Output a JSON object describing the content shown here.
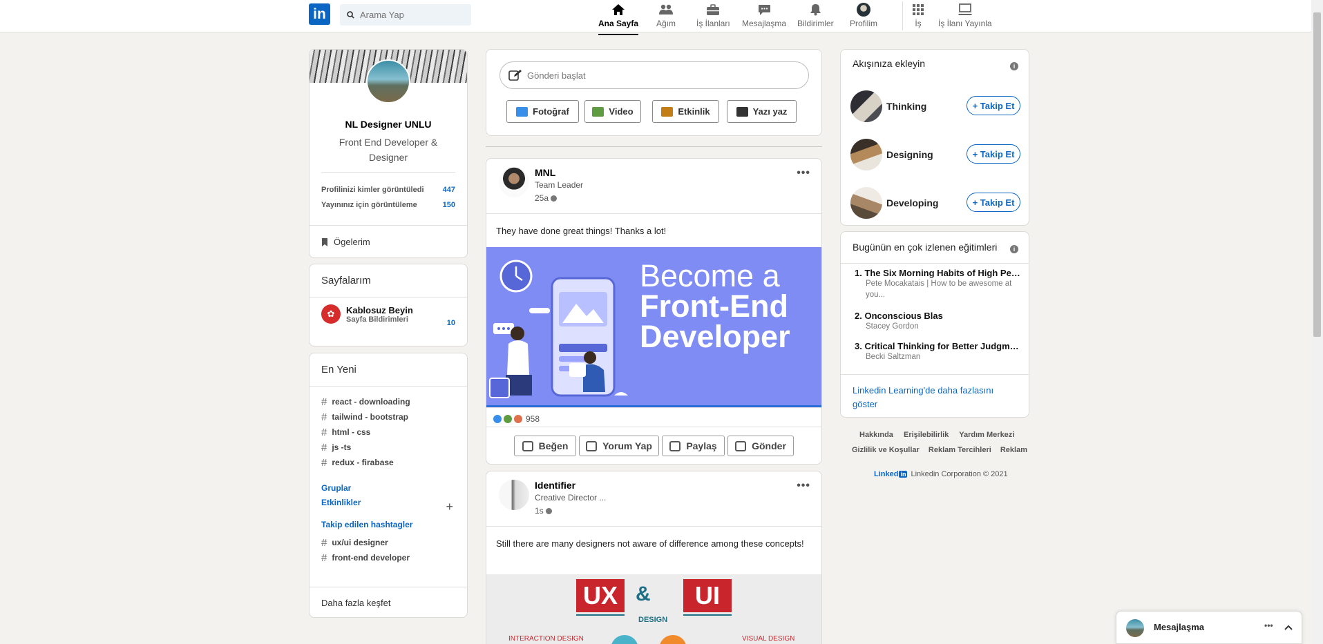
{
  "nav": {
    "logo_text": "in",
    "search_placeholder": "Arama Yap",
    "items": [
      {
        "label": "Ana Sayfa",
        "icon": "home-icon"
      },
      {
        "label": "Ağım",
        "icon": "network-icon"
      },
      {
        "label": "İş İlanları",
        "icon": "briefcase-icon"
      },
      {
        "label": "Mesajlaşma",
        "icon": "chat-icon"
      },
      {
        "label": "Bildirimler",
        "icon": "bell-icon"
      },
      {
        "label": "Profilim",
        "icon": "avatar"
      },
      {
        "label": "İş",
        "icon": "grid-icon"
      },
      {
        "label": "İş İlanı Yayınla",
        "icon": "laptop-icon"
      }
    ]
  },
  "profile": {
    "name": "NL Designer UNLU",
    "title": "Front End Developer & Designer",
    "stats": [
      {
        "label": "Profilinizi kimler görüntüledi",
        "value": "447"
      },
      {
        "label": "Yayınınız için görüntüleme",
        "value": "150"
      }
    ],
    "items_label": "Ögelerim"
  },
  "pages": {
    "title": "Sayfalarım",
    "page_name": "Kablosuz Beyin",
    "page_sub": "Sayfa Bildirimleri",
    "count": "10"
  },
  "recent": {
    "title": "En Yeni",
    "tags": [
      "react - downloading",
      "tailwind - bootstrap",
      "html - css",
      "js -ts",
      "redux - firabase"
    ],
    "groups_label": "Gruplar",
    "events_label": "Etkinlikler",
    "plus": "+",
    "followed_label": "Takip edilen hashtagler",
    "followed_tags": [
      "ux/ui designer",
      "front-end developer"
    ],
    "discover_label": "Daha fazla keşfet"
  },
  "composer": {
    "placeholder": "Gönderi başlat",
    "buttons": [
      {
        "label": "Fotoğraf",
        "color": "#378fe9"
      },
      {
        "label": "Video",
        "color": "#5f9b41"
      },
      {
        "label": "Etkinlik",
        "color": "#c37d16"
      },
      {
        "label": "Yazı yaz",
        "color": "#333333"
      }
    ]
  },
  "posts": [
    {
      "name": "MNL",
      "subtitle": "Team Leader",
      "time": "25a",
      "text": "They have done great things! Thanks a lot!",
      "image_headline_1": "Become a",
      "image_headline_2": "Front-End",
      "image_headline_3": "Developer",
      "reactions": "958"
    },
    {
      "name": "Identifier",
      "subtitle": "Creative Director ...",
      "time": "1s",
      "text": "Still there are many designers not aware of difference among these concepts!",
      "image_ux": "UX",
      "image_amp": "&",
      "image_ui": "UI",
      "image_design": "DESIGN",
      "image_left": "INTERACTION DESIGN",
      "image_right": "VISUAL DESIGN"
    }
  ],
  "post_actions": [
    "Beğen",
    "Yorum Yap",
    "Paylaş",
    "Gönder"
  ],
  "feed": {
    "title": "Akışınıza ekleyin",
    "follow_label": "+ Takip Et",
    "items": [
      "Thinking",
      "Designing",
      "Developing"
    ]
  },
  "courses": {
    "title": "Bugünün en çok izlenen eğitimleri",
    "items": [
      {
        "title": "1. The Six Morning Habits of High Perf...",
        "author": "Pete Mocakatais | How to be awesome at you..."
      },
      {
        "title": "2. Onconscious Blas",
        "author": "Stacey Gordon"
      },
      {
        "title": "3. Critical Thinking for Better Judgme...",
        "author": "Becki Saltzman"
      }
    ],
    "more_link": "Linkedin Learning'de daha fazlasını göster"
  },
  "footer": {
    "row1": [
      "Hakkında",
      "Erişilebilirlik",
      "Yardım Merkezi"
    ],
    "row2": [
      "Gizlilik ve Koşullar",
      "Reklam Tercihleri",
      "Reklam"
    ],
    "brand": "Linked",
    "brand_in": "in",
    "copyright": "Linkedin Corporation © 2021"
  },
  "messaging": {
    "label": "Mesajlaşma"
  },
  "colors": {
    "accent": "#0a66c2",
    "background": "#f3f2ef",
    "image_bg": "#7f8cf4"
  }
}
